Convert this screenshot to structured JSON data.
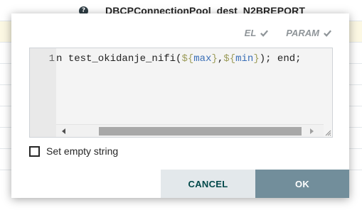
{
  "background": {
    "help_icon_glyph": "?",
    "value_text": "DBCPConnectionPool_dest_N2BREPORT",
    "highlight_color": "#fcf8e3",
    "row_border_color": "#e3e8eb"
  },
  "popup": {
    "flags": {
      "el_label": "EL",
      "param_label": "PARAM",
      "color": "#8f9599"
    },
    "editor": {
      "line_number": "1",
      "code": {
        "prefix": "n test_okidanje_nifi(",
        "dollar1": "$",
        "brace1_open": "{",
        "var1": "max",
        "brace1_close": "}",
        "comma": ",",
        "dollar2": "$",
        "brace2_open": "{",
        "var2": "min",
        "brace2_close": "}",
        "suffix": "); end;"
      }
    },
    "set_empty_string": {
      "label": "Set empty string",
      "checked": false
    },
    "buttons": {
      "cancel_label": "CANCEL",
      "ok_label": "OK",
      "cancel_color": "#e3e8eb",
      "ok_color": "#728e9b"
    }
  }
}
